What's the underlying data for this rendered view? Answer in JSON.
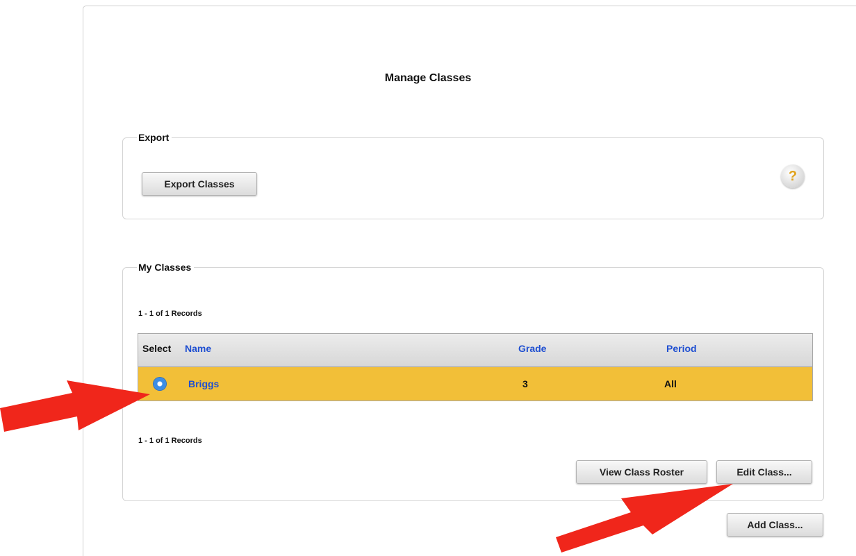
{
  "page": {
    "title": "Manage Classes"
  },
  "export": {
    "legend": "Export",
    "export_button": "Export Classes",
    "help_glyph": "?"
  },
  "my_classes": {
    "legend": "My Classes",
    "records_top": "1 - 1 of 1 Records",
    "records_bottom": "1 - 1 of 1 Records",
    "columns": {
      "select": "Select",
      "name": "Name",
      "grade": "Grade",
      "period": "Period"
    },
    "rows": [
      {
        "name": "Briggs",
        "grade": "3",
        "period": "All",
        "selected": true
      }
    ],
    "view_roster_button": "View Class Roster",
    "edit_class_button": "Edit Class..."
  },
  "add_class_button": "Add Class...",
  "colors": {
    "selected_row": "#f2bf38",
    "link": "#1f4fd1",
    "annotation_arrow": "#f0261b"
  },
  "icons": {
    "help": "question-mark-icon",
    "radio": "radio-selected-icon",
    "annotation": "red-arrow-icon"
  }
}
